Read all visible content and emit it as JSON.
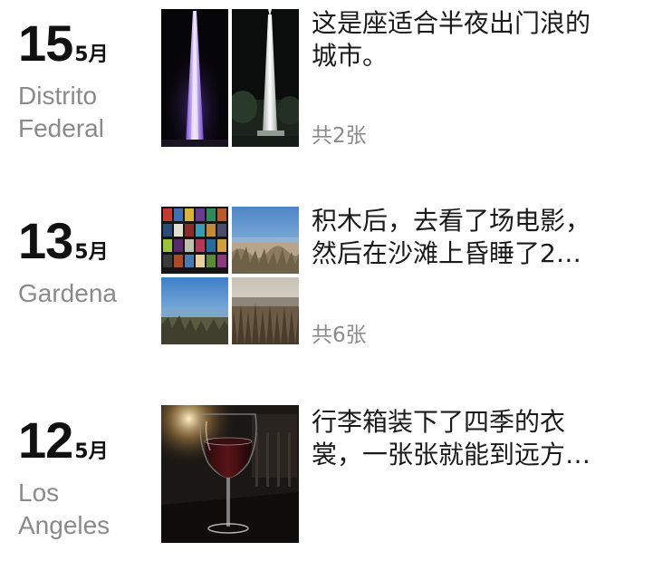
{
  "posts": [
    {
      "day": "15",
      "month": "5月",
      "city_lines": [
        "Distrito",
        "Federal"
      ],
      "excerpt_lines": [
        "这是座适合半夜出门浪的",
        "城市。"
      ],
      "photo_count": "共2张",
      "photos": [
        "night-obelisk-purple-photo",
        "night-obelisk-white-photo"
      ]
    },
    {
      "day": "13",
      "month": "5月",
      "city_lines": [
        "Gardena"
      ],
      "excerpt_lines": [
        "积木后，去看了场电影，",
        "然后在沙滩上昏睡了2…"
      ],
      "photo_count": "共6张",
      "photos": [
        "movie-poster-wall-photo",
        "beach-dunes-photo",
        "beach-shore-photo",
        "beach-grass-photo"
      ]
    },
    {
      "day": "12",
      "month": "5月",
      "city_lines": [
        "Los",
        "Angeles"
      ],
      "excerpt_lines": [
        "行李箱装下了四季的衣",
        "裳，一张张就能到远方…"
      ],
      "photos": [
        "wine-glass-photo"
      ]
    }
  ]
}
